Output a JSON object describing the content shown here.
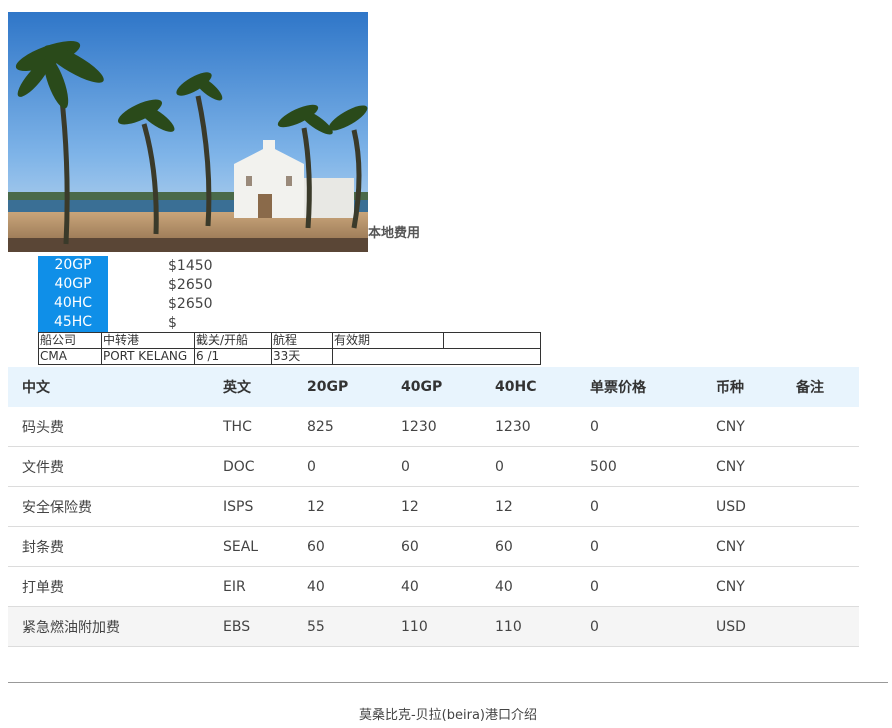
{
  "local_fees": {
    "title": "本地费用"
  },
  "container_prices": [
    {
      "type": "20GP",
      "price": "$1450"
    },
    {
      "type": "40GP",
      "price": "$2650"
    },
    {
      "type": "40HC",
      "price": "$2650"
    },
    {
      "type": "45HC",
      "price": "$"
    }
  ],
  "route_table": {
    "headers": [
      "船公司",
      "中转港",
      "截关/开船",
      "航程",
      "有效期",
      ""
    ],
    "row": [
      "CMA",
      "PORT KELANG",
      "6 /1",
      "33天",
      "",
      ""
    ]
  },
  "fee_table": {
    "headers": [
      "中文",
      "英文",
      "20GP",
      "40GP",
      "40HC",
      "单票价格",
      "币种",
      "备注"
    ],
    "rows": [
      [
        "码头费",
        "THC",
        "825",
        "1230",
        "1230",
        "0",
        "CNY",
        ""
      ],
      [
        "文件费",
        "DOC",
        "0",
        "0",
        "0",
        "500",
        "CNY",
        ""
      ],
      [
        "安全保险费",
        "ISPS",
        "12",
        "12",
        "12",
        "0",
        "USD",
        ""
      ],
      [
        "封条费",
        "SEAL",
        "60",
        "60",
        "60",
        "0",
        "CNY",
        ""
      ],
      [
        "打单费",
        "EIR",
        "40",
        "40",
        "40",
        "0",
        "CNY",
        ""
      ],
      [
        "紧急燃油附加费",
        "EBS",
        "55",
        "110",
        "110",
        "0",
        "USD",
        ""
      ]
    ]
  },
  "footer": {
    "port_intro_link": "莫桑比克-贝拉(beira)港口介绍"
  },
  "colors": {
    "accent": "#0f8fe8",
    "table_header_bg": "#e8f4fd",
    "highlight_row_bg": "#f5f5f5"
  }
}
